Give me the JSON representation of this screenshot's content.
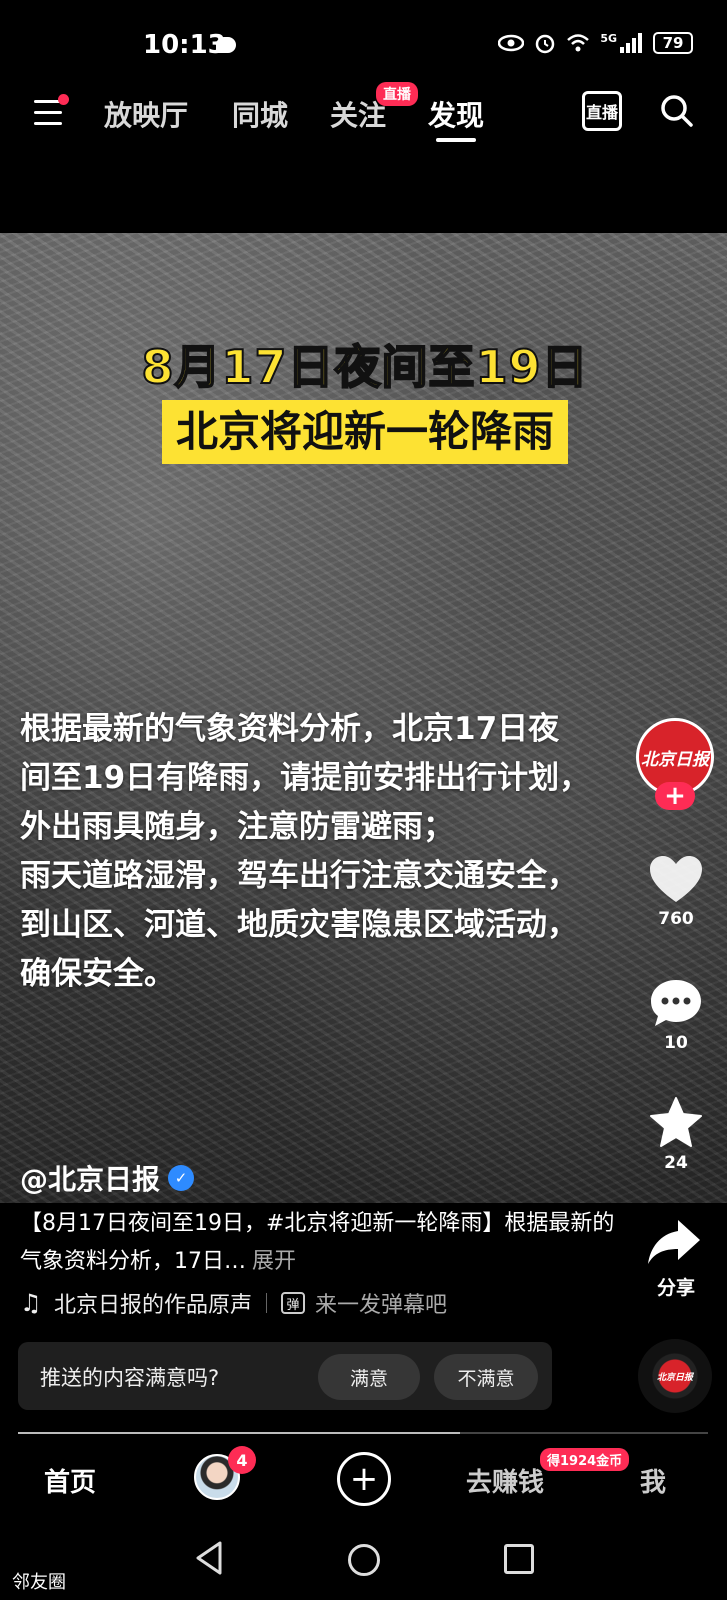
{
  "status_bar": {
    "time": "10:13",
    "battery": "79",
    "network": "5G"
  },
  "top_nav": {
    "tabs": [
      {
        "label": "放映厅"
      },
      {
        "label": "同城"
      },
      {
        "label": "关注"
      },
      {
        "label": "发现"
      }
    ],
    "active_tab": "发现",
    "live_badge": "直播",
    "live_button_label": "直播"
  },
  "video": {
    "headline_line1": "8月17日夜间至19日",
    "headline_line2": "北京将迎新一轮降雨",
    "body_text": "根据最新的气象资料分析，北京17日夜\n间至19日有降雨，请提前安排出行计划，\n外出雨具随身，注意防雷避雨；\n雨天道路湿滑，驾车出行注意交通安全，\n到山区、河道、地质灾害隐患区域活动，\n确保安全。",
    "author": "@北京日报",
    "avatar_text": "北京日报"
  },
  "rail": {
    "likes": "760",
    "comments": "10",
    "favorites": "24",
    "share_label": "分享"
  },
  "caption": {
    "text": "【8月17日夜间至19日，#北京将迎新一轮降雨】根据最新的气象资料分析，17日…",
    "more": "展开",
    "music": "北京日报的作品原声",
    "danmu": "来一发弹幕吧"
  },
  "survey": {
    "question": "推送的内容满意吗?",
    "satisfied": "满意",
    "unsatisfied": "不满意"
  },
  "progress": 0.64,
  "bottom_tabs": {
    "home": "首页",
    "message_badge": "4",
    "earn": "去赚钱",
    "coin_badge": "得1924金币",
    "me": "我"
  },
  "system_nav": {
    "friends_label": "邻友圈"
  },
  "colors": {
    "accent": "#fe2c55",
    "headline_yellow": "#fde233",
    "verify_blue": "#2e8bff",
    "brand_red": "#d8232a"
  }
}
